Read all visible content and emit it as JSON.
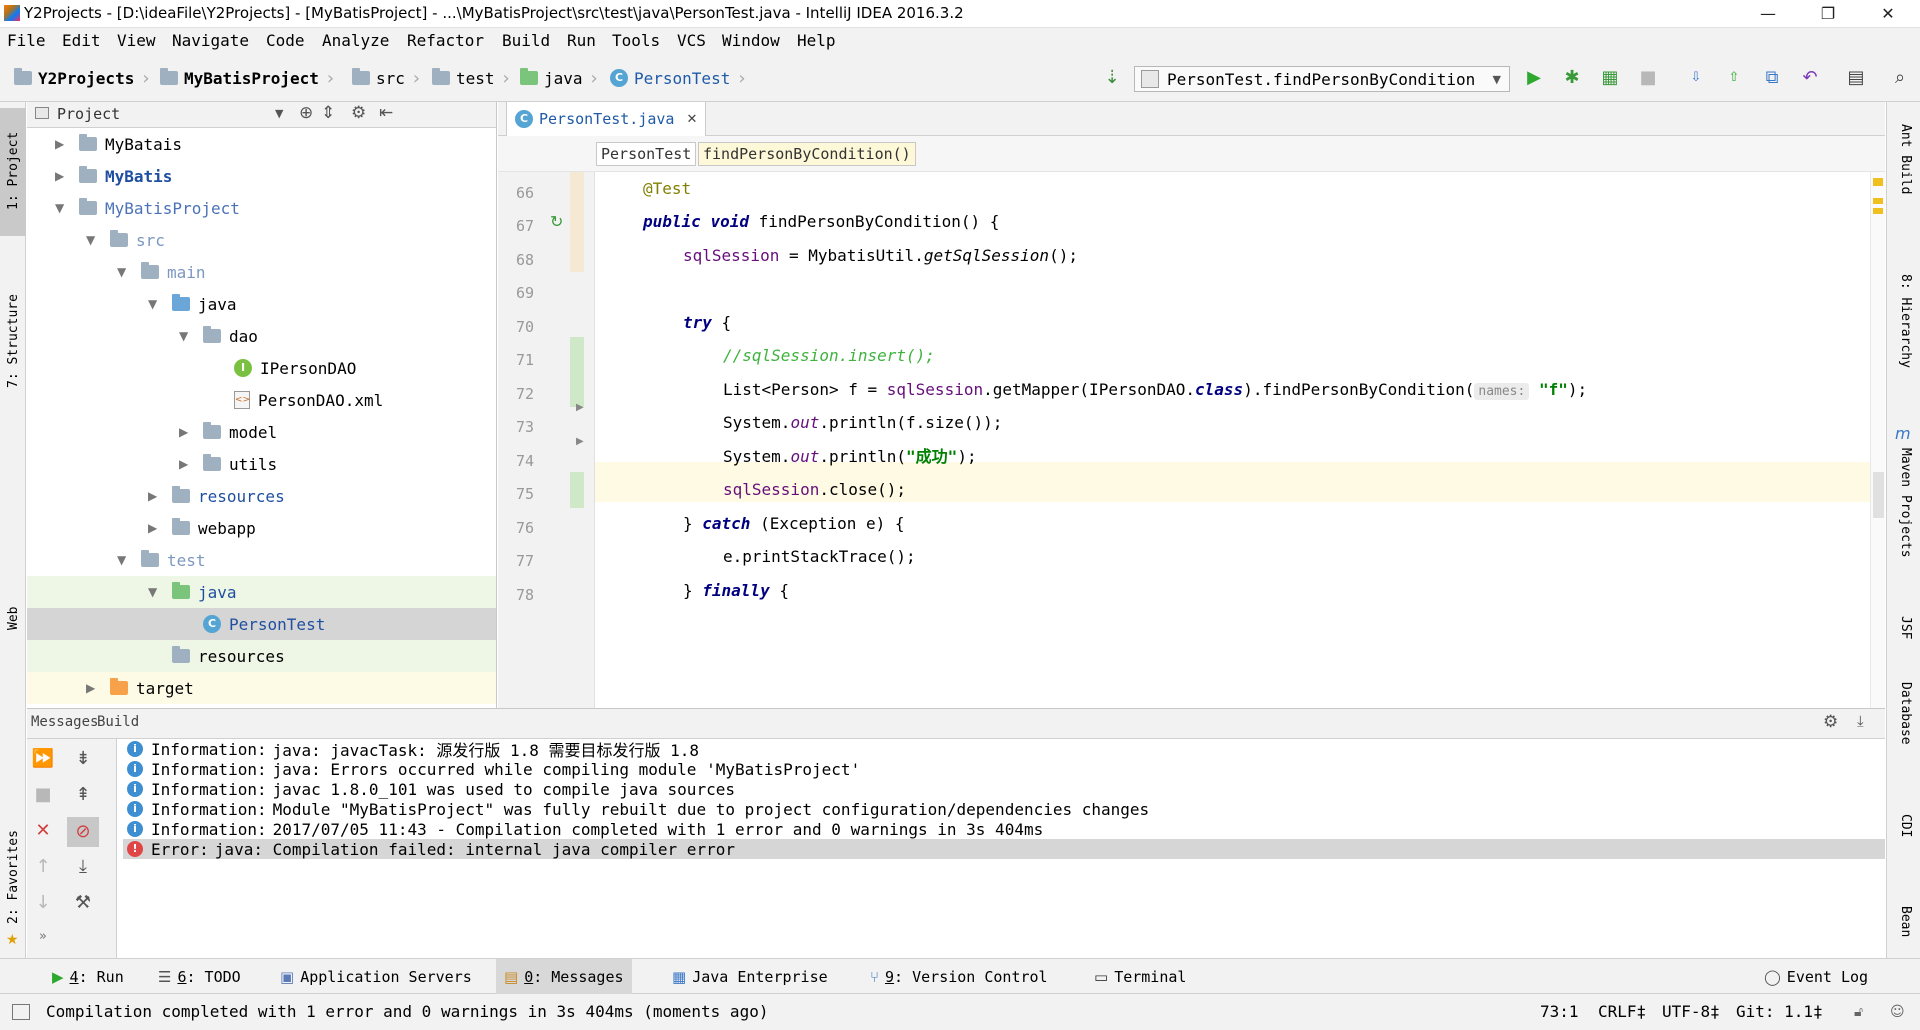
{
  "window": {
    "title": "Y2Projects - [D:\\ideaFile\\Y2Projects] - [MyBatisProject] - ...\\MyBatisProject\\src\\test\\java\\PersonTest.java - IntelliJ IDEA 2016.3.2",
    "minimize": "—",
    "maximize": "❐",
    "close": "✕"
  },
  "menu": [
    "File",
    "Edit",
    "View",
    "Navigate",
    "Code",
    "Analyze",
    "Refactor",
    "Build",
    "Run",
    "Tools",
    "VCS",
    "Window",
    "Help"
  ],
  "breadcrumbs": [
    "Y2Projects",
    "MyBatisProject",
    "src",
    "test",
    "java",
    "PersonTest"
  ],
  "run_config": "PersonTest.findPersonByCondition",
  "left_stripe": [
    "1: Project",
    "7: Structure",
    "Web",
    "2: Favorites"
  ],
  "right_stripe": [
    "Ant Build",
    "8: Hierarchy",
    "Maven Projects",
    "JSF",
    "Database",
    "CDI",
    "Bean"
  ],
  "project": {
    "header": "Project",
    "tree": [
      {
        "label": "MyBatais",
        "depth": 0,
        "arrow": "▶",
        "icon": "module-folder-icon",
        "color": "#000000"
      },
      {
        "label": "MyBatis",
        "depth": 0,
        "arrow": "▶",
        "icon": "module-folder-icon",
        "color": "#1f4fa0"
      },
      {
        "label": "MyBatisProject",
        "depth": 0,
        "arrow": "▼",
        "icon": "module-folder-icon",
        "color": "#4b72b8"
      },
      {
        "label": "src",
        "depth": 1,
        "arrow": "▼",
        "icon": "folder-icon",
        "color": "#7b98c0"
      },
      {
        "label": "main",
        "depth": 2,
        "arrow": "▼",
        "icon": "folder-icon",
        "color": "#7b98c0"
      },
      {
        "label": "java",
        "depth": 3,
        "arrow": "▼",
        "icon": "source-folder-icon",
        "color": "#000000"
      },
      {
        "label": "dao",
        "depth": 4,
        "arrow": "▼",
        "icon": "package-icon",
        "color": "#000000"
      },
      {
        "label": "IPersonDAO",
        "depth": 5,
        "arrow": "",
        "icon": "interface-icon",
        "color": "#000000"
      },
      {
        "label": "PersonDAO.xml",
        "depth": 5,
        "arrow": "",
        "icon": "xml-file-icon",
        "color": "#000000"
      },
      {
        "label": "model",
        "depth": 4,
        "arrow": "▶",
        "icon": "package-icon",
        "color": "#000000"
      },
      {
        "label": "utils",
        "depth": 4,
        "arrow": "▶",
        "icon": "package-icon",
        "color": "#000000"
      },
      {
        "label": "resources",
        "depth": 3,
        "arrow": "▶",
        "icon": "resources-folder-icon",
        "color": "#1f4fa0"
      },
      {
        "label": "webapp",
        "depth": 3,
        "arrow": "▶",
        "icon": "folder-icon",
        "color": "#000000"
      },
      {
        "label": "test",
        "depth": 2,
        "arrow": "▼",
        "icon": "folder-icon",
        "color": "#7b98c0"
      },
      {
        "label": "java",
        "depth": 3,
        "arrow": "▼",
        "icon": "test-folder-icon",
        "color": "#1f4fa0"
      },
      {
        "label": "PersonTest",
        "depth": 4,
        "arrow": "",
        "icon": "class-icon",
        "color": "#1f4fa0"
      },
      {
        "label": "resources",
        "depth": 3,
        "arrow": "",
        "icon": "resources-folder-icon",
        "color": "#000000"
      },
      {
        "label": "target",
        "depth": 1,
        "arrow": "▶",
        "icon": "excluded-folder-icon",
        "color": "#000000"
      }
    ]
  },
  "editor": {
    "tab": "PersonTest.java",
    "crumbs": [
      "PersonTest",
      "findPersonByCondition()"
    ],
    "lines": [
      "66",
      "67",
      "68",
      "69",
      "70",
      "71",
      "72",
      "73",
      "74",
      "75",
      "76",
      "77",
      "78"
    ],
    "code": {
      "l66": "@Test",
      "l67_kw1": "public",
      "l67_kw2": "void",
      "l67_rest": " findPersonByCondition() {",
      "l68_fld": "sqlSession",
      "l68_a": " = MybatisUtil.",
      "l68_m": "getSqlSession",
      "l68_b": "();",
      "l70_kw": "try",
      "l70_rest": " {",
      "l71": "//sqlSession.insert();",
      "l72_a": "List<Person> f = ",
      "l72_fld": "sqlSession",
      "l72_b": ".getMapper(IPersonDAO.",
      "l72_kw": "class",
      "l72_c": ").findPersonByCondition(",
      "l72_hint": "names:",
      "l72_str": "\"f\"",
      "l72_d": ");",
      "l73_a": "System.",
      "l73_out": "out",
      "l73_b": ".println(f.size());",
      "l74_a": "System.",
      "l74_out": "out",
      "l74_b": ".println(",
      "l74_str": "\"成功\"",
      "l74_c": ");",
      "l75_fld": "sqlSession",
      "l75_rest": ".close();",
      "l76_a": "} ",
      "l76_kw": "catch",
      "l76_rest": " (Exception e) {",
      "l77": "e.printStackTrace();",
      "l78_a": "} ",
      "l78_kw": "finally",
      "l78_rest": " {"
    }
  },
  "messages": {
    "tabs": [
      "Messages",
      "Build"
    ],
    "rows": [
      {
        "type": "info",
        "label": "Information:",
        "text": "java: javacTask: 源发行版 1.8 需要目标发行版 1.8"
      },
      {
        "type": "info",
        "label": "Information:",
        "text": "java: Errors occurred while compiling module 'MyBatisProject'"
      },
      {
        "type": "info",
        "label": "Information:",
        "text": "javac 1.8.0_101 was used to compile java sources"
      },
      {
        "type": "info",
        "label": "Information:",
        "text": "Module \"MyBatisProject\" was fully rebuilt due to project configuration/dependencies changes"
      },
      {
        "type": "info",
        "label": "Information:",
        "text": "2017/07/05 11:43 - Compilation completed with 1 error and 0 warnings in 3s 404ms"
      },
      {
        "type": "error",
        "label": "Error:",
        "text": "java: Compilation failed: internal java compiler error"
      }
    ]
  },
  "toolwindows": [
    {
      "key": "4",
      "label": ": Run"
    },
    {
      "key": "6",
      "label": ": TODO"
    },
    {
      "key": "",
      "label": "Application Servers"
    },
    {
      "key": "0",
      "label": ": Messages"
    },
    {
      "key": "",
      "label": "Java Enterprise"
    },
    {
      "key": "9",
      "label": ": Version Control"
    },
    {
      "key": "",
      "label": "Terminal"
    }
  ],
  "event_log": "Event Log",
  "status": {
    "message": "Compilation completed with 1 error and 0 warnings in 3s 404ms (moments ago)",
    "position": "73:1",
    "line_sep": "CRLF‡",
    "encoding": "UTF-8‡",
    "git": "Git: 1.1‡"
  }
}
